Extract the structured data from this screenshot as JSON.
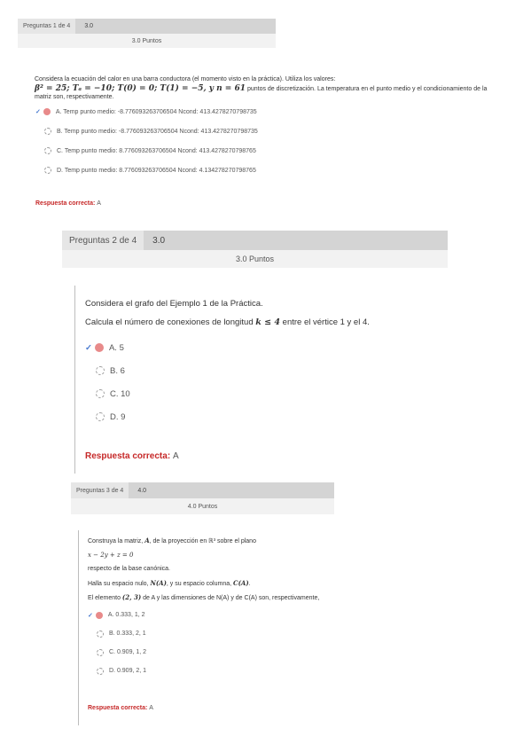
{
  "q1": {
    "header": "Preguntas 1 de 4",
    "score": "3.0",
    "points": "3.0 Puntos",
    "text1": "Considera la ecuación del calor en una barra conductora (el momento visto en la práctica). Utiliza los valores:",
    "math": "β² = 25; Tₐ = −10; T(0) = 0; T(1) = −5, y n = 61",
    "text2": "puntos de discretización. La temperatura en el punto medio y el condicionamiento de la",
    "text3": "matriz son, respectivamente.",
    "options": [
      {
        "label": "A. Temp punto medio: -8.776093263706504 Ncond: 413.4278270798735"
      },
      {
        "label": "B. Temp punto medio: -8.776093263706504 Ncond: 413.4278270798735"
      },
      {
        "label": "C. Temp punto medio: 8.776093263706504 Ncond: 413.4278270798765"
      },
      {
        "label": "D. Temp punto medio: 8.776093263706504 Ncond: 4.134278270798765"
      }
    ],
    "answer_label": "Respuesta correcta:",
    "answer_value": "A"
  },
  "q2": {
    "header": "Preguntas 2 de 4",
    "score": "3.0",
    "points": "3.0 Puntos",
    "text1": "Considera el grafo del Ejemplo 1 de la Práctica.",
    "text2a": "Calcula el número de conexiones de longitud ",
    "text2math": "k ≤ 4",
    "text2b": " entre el vértice 1 y el 4.",
    "options": [
      {
        "label": "A. 5"
      },
      {
        "label": "B. 6"
      },
      {
        "label": "C. 10"
      },
      {
        "label": "D. 9"
      }
    ],
    "answer_label": "Respuesta correcta:",
    "answer_value": "A"
  },
  "q3": {
    "header": "Preguntas 3 de 4",
    "score": "4.0",
    "points": "4.0 Puntos",
    "text1a": "Construya la matriz, ",
    "text1m": "A",
    "text1b": ", de la proyección en ℝ³ sobre el plano",
    "text2": "x − 2y + z = 0",
    "text3": "respecto de la base canónica.",
    "text4a": "Halla su espacio nulo, ",
    "text4m": "N(A)",
    "text4b": ", y su espacio columna, ",
    "text4m2": "C(A)",
    "text4c": ".",
    "text5a": "El elemento ",
    "text5m": "(2, 3)",
    "text5b": " de A y las dimensiones de N(A) y de C(A) son, respectivamente,",
    "options": [
      {
        "label": "A. 0.333, 1, 2"
      },
      {
        "label": "B. 0.333, 2, 1"
      },
      {
        "label": "C. 0.909, 1, 2"
      },
      {
        "label": "D. 0.909, 2, 1"
      }
    ],
    "answer_label": "Respuesta correcta:",
    "answer_value": "A"
  }
}
